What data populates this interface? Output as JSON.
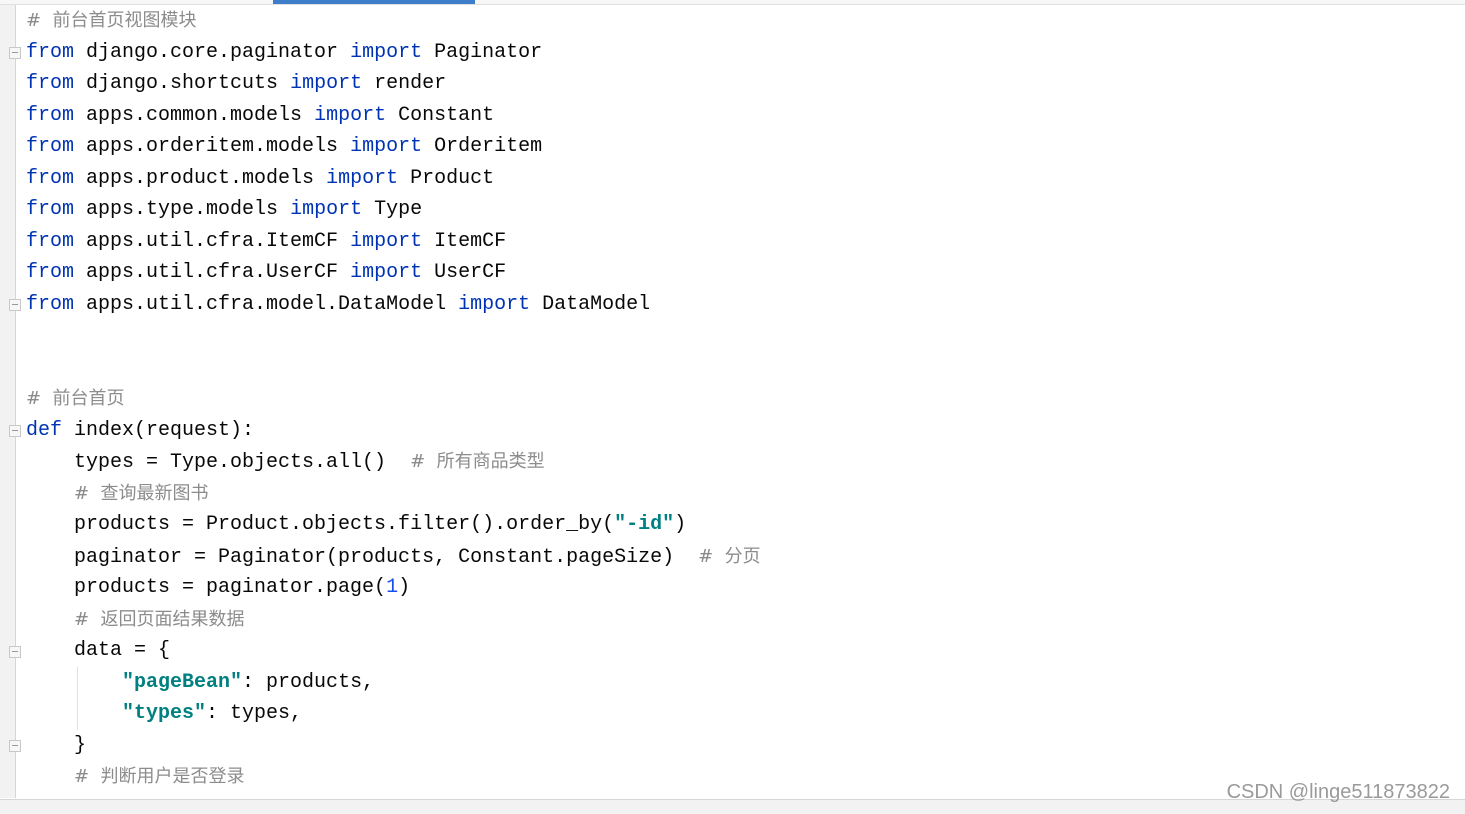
{
  "editor": {
    "lines": [
      [
        [
          "c",
          "#  前台首页视图模块"
        ]
      ],
      [
        [
          "k",
          "from"
        ],
        [
          "t",
          " django.core.paginator "
        ],
        [
          "k",
          "import"
        ],
        [
          "t",
          " Paginator"
        ]
      ],
      [
        [
          "k",
          "from"
        ],
        [
          "t",
          " django.shortcuts "
        ],
        [
          "k",
          "import"
        ],
        [
          "t",
          " render"
        ]
      ],
      [
        [
          "k",
          "from"
        ],
        [
          "t",
          " apps.common.models "
        ],
        [
          "k",
          "import"
        ],
        [
          "t",
          " Constant"
        ]
      ],
      [
        [
          "k",
          "from"
        ],
        [
          "t",
          " apps.orderitem.models "
        ],
        [
          "k",
          "import"
        ],
        [
          "t",
          " Orderitem"
        ]
      ],
      [
        [
          "k",
          "from"
        ],
        [
          "t",
          " apps.product.models "
        ],
        [
          "k",
          "import"
        ],
        [
          "t",
          " Product"
        ]
      ],
      [
        [
          "k",
          "from"
        ],
        [
          "t",
          " apps.type.models "
        ],
        [
          "k",
          "import"
        ],
        [
          "t",
          " Type"
        ]
      ],
      [
        [
          "k",
          "from"
        ],
        [
          "t",
          " apps.util.cfra.ItemCF "
        ],
        [
          "k",
          "import"
        ],
        [
          "t",
          " ItemCF"
        ]
      ],
      [
        [
          "k",
          "from"
        ],
        [
          "t",
          " apps.util.cfra.UserCF "
        ],
        [
          "k",
          "import"
        ],
        [
          "t",
          " UserCF"
        ]
      ],
      [
        [
          "k",
          "from"
        ],
        [
          "t",
          " apps.util.cfra.model.DataModel "
        ],
        [
          "k",
          "import"
        ],
        [
          "t",
          " DataModel"
        ]
      ],
      [],
      [],
      [
        [
          "c",
          "#  前台首页"
        ]
      ],
      [
        [
          "k",
          "def"
        ],
        [
          "t",
          " index(request):"
        ]
      ],
      [
        [
          "t",
          "    types = Type.objects.all()  "
        ],
        [
          "c",
          "#  所有商品类型"
        ]
      ],
      [
        [
          "t",
          "    "
        ],
        [
          "c",
          "#  查询最新图书"
        ]
      ],
      [
        [
          "t",
          "    products = Product.objects.filter().order_by("
        ],
        [
          "s",
          "\"-id\""
        ],
        [
          "t",
          ")"
        ]
      ],
      [
        [
          "t",
          "    paginator = Paginator(products, Constant.pageSize)  "
        ],
        [
          "c",
          "#  分页"
        ]
      ],
      [
        [
          "t",
          "    products = paginator.page("
        ],
        [
          "n",
          "1"
        ],
        [
          "t",
          ")"
        ]
      ],
      [
        [
          "t",
          "    "
        ],
        [
          "c",
          "#  返回页面结果数据"
        ]
      ],
      [
        [
          "t",
          "    data = {"
        ]
      ],
      [
        [
          "t",
          "        "
        ],
        [
          "s",
          "\"pageBean\""
        ],
        [
          "t",
          ": products,"
        ]
      ],
      [
        [
          "t",
          "        "
        ],
        [
          "s",
          "\"types\""
        ],
        [
          "t",
          ": types,"
        ]
      ],
      [
        [
          "t",
          "    }"
        ]
      ],
      [
        [
          "t",
          "    "
        ],
        [
          "c",
          "#  判断用户是否登录"
        ]
      ]
    ]
  },
  "watermark": "CSDN @linge511873822",
  "colors": {
    "keyword": "#0033b3",
    "string": "#008080",
    "comment": "#8c8c8c",
    "number": "#1750eb",
    "tab_active": "#3d7dca"
  }
}
